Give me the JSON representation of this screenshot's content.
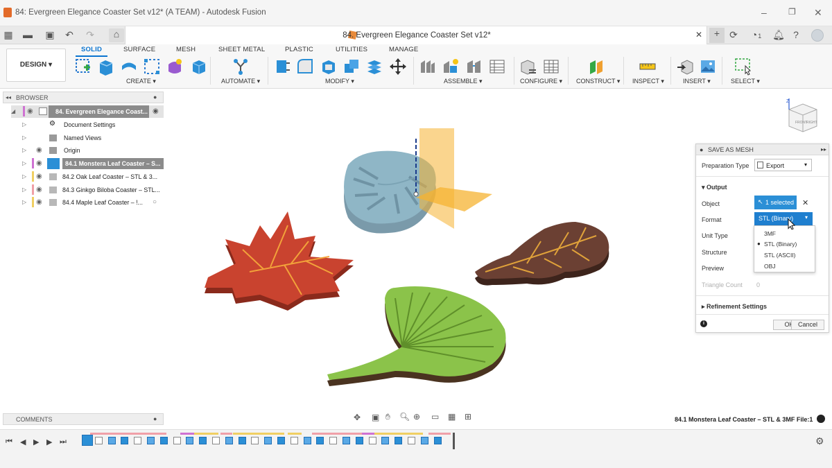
{
  "window": {
    "title": "84: Evergreen Elegance Coaster Set v12* (A TEAM) - Autodesk Fusion",
    "doc_tab": "84. Evergreen Elegance Coaster Set v12*",
    "badge_count": "1"
  },
  "toolbar": {
    "workspace": "DESIGN",
    "tabs": [
      "SOLID",
      "SURFACE",
      "MESH",
      "SHEET METAL",
      "PLASTIC",
      "UTILITIES",
      "MANAGE"
    ],
    "active_tab": "SOLID",
    "groups": [
      "CREATE",
      "AUTOMATE",
      "MODIFY",
      "ASSEMBLE",
      "CONFIGURE",
      "CONSTRUCT",
      "INSPECT",
      "INSERT",
      "SELECT"
    ]
  },
  "browser": {
    "title": "BROWSER",
    "root": "84. Evergreen Elegance Coast...",
    "items": [
      {
        "label": "Document Settings",
        "bar": ""
      },
      {
        "label": "Named Views",
        "bar": ""
      },
      {
        "label": "Origin",
        "bar": ""
      },
      {
        "label": "84.1 Monstera Leaf Coaster – S...",
        "bar": "#cf72d2"
      },
      {
        "label": "84.2 Oak Leaf Coaster – STL & 3...",
        "bar": "#f0cf62"
      },
      {
        "label": "84.3 Ginkgo Biloba Coaster – STL...",
        "bar": "#f0a0a8"
      },
      {
        "label": "84.4 Maple Leaf Coaster – !...",
        "bar": "#f0cf62"
      }
    ]
  },
  "comments": {
    "title": "COMMENTS"
  },
  "dialog": {
    "title": "SAVE AS MESH",
    "prep_label": "Preparation Type",
    "prep_value": "Export",
    "output_section": "Output",
    "object_label": "Object",
    "object_value": "1 selected",
    "format_label": "Format",
    "format_value": "STL (Binary)",
    "unit_label": "Unit Type",
    "structure_label": "Structure",
    "preview_label": "Preview",
    "triangle_label": "Triangle Count",
    "triangle_value": "0",
    "refinement_section": "Refinement Settings",
    "ok": "OK",
    "cancel": "Cancel",
    "format_options": [
      "3MF",
      "STL (Binary)",
      "STL (ASCII)",
      "OBJ"
    ],
    "selected_option": "STL (Binary)"
  },
  "status": {
    "selection": "84.1 Monstera Leaf Coaster – STL & 3MF File:1"
  },
  "colors": {
    "accent": "#0a74d0",
    "selected": "#2b8fd6",
    "maple": "#c9432f",
    "oak": "#6b4033",
    "ginkgo": "#8bc34a",
    "monstera": "#8fb6c6",
    "plane": "#f5b331"
  }
}
